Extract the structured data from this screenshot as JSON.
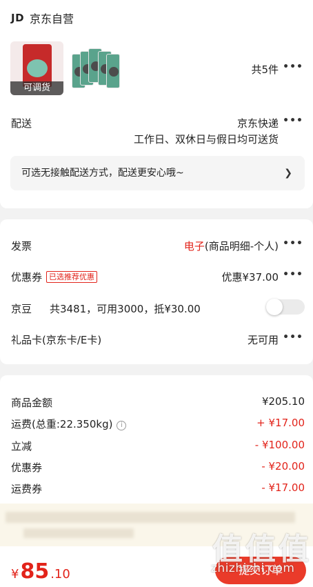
{
  "store": {
    "logo": "JD",
    "name": "京东自营"
  },
  "products": {
    "first_tag": "可调货",
    "count": "共5件"
  },
  "delivery": {
    "label": "配送",
    "method": "京东快递",
    "schedule": "工作日、双休日与假日均可送货",
    "notice": "可选无接触配送方式，配送更安心哦~"
  },
  "invoice": {
    "label": "发票",
    "type": "电子",
    "detail": "(商品明细-个人)"
  },
  "coupon": {
    "label": "优惠券",
    "badge": "已选推荐优惠",
    "value": "优惠¥37.00"
  },
  "jingdou": {
    "label": "京豆",
    "text": "共3481，可用3000，抵¥30.00",
    "enabled": false
  },
  "giftcard": {
    "label": "礼品卡(京东卡/E卡)",
    "value": "无可用"
  },
  "summary": {
    "goods_label": "商品金额",
    "goods_value": "¥205.10",
    "shipping_label": "运费(总重:22.350kg)",
    "shipping_value": "+ ¥17.00",
    "discount_label": "立减",
    "discount_value": "- ¥100.00",
    "coupon_label": "优惠券",
    "coupon_value": "- ¥20.00",
    "shipping_off_label": "运费券",
    "shipping_off_value": "- ¥17.00"
  },
  "total": {
    "currency": "¥",
    "integer": "85",
    "decimal": ".10"
  },
  "submit_label": "提交订单",
  "watermark": {
    "glyphs": "值",
    "site": "zhizhizhi.com"
  },
  "colors": {
    "accent": "#e2231a",
    "button": "#ea3b2a"
  }
}
